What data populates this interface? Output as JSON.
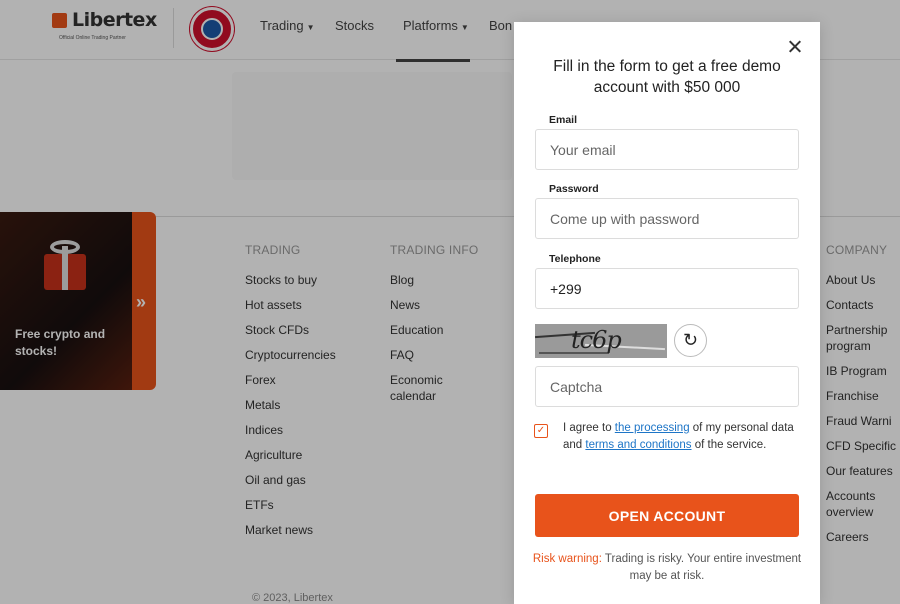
{
  "header": {
    "logo_text": "Libertex",
    "logo_subtitle": "Official Online Trading Partner",
    "nav": [
      {
        "label": "Trading"
      },
      {
        "label": "Stocks"
      },
      {
        "label": "Platforms"
      },
      {
        "label": "Bon"
      }
    ]
  },
  "promo": {
    "text": "Free crypto and stocks!",
    "chevron": "»"
  },
  "footer": {
    "columns": [
      {
        "heading": "TRADING",
        "items": [
          "Stocks to buy",
          "Hot assets",
          "Stock CFDs",
          "Cryptocurrencies",
          "Forex",
          "Metals",
          "Indices",
          "Agriculture",
          "Oil and gas",
          "ETFs",
          "Market news"
        ]
      },
      {
        "heading": "TRADING INFO",
        "items": [
          "Blog",
          "News",
          "Education",
          "FAQ",
          "Economic calendar"
        ]
      },
      {
        "heading": "COMPANY",
        "items": [
          "About Us",
          "Contacts",
          "Partnership program",
          "IB Program",
          "Franchise",
          "Fraud Warni",
          "CFD Specific",
          "Our features",
          "Accounts overview",
          "Careers"
        ]
      }
    ],
    "copyright": "© 2023, Libertex"
  },
  "modal": {
    "title": "Fill in the form to get a free demo account with $50 000",
    "email_label": "Email",
    "email_placeholder": "Your email",
    "password_label": "Password",
    "password_placeholder": "Come up with password",
    "telephone_label": "Telephone",
    "telephone_value": "+299",
    "captcha_text": "tc6p",
    "captcha_placeholder": "Captcha",
    "consent_prefix": "I agree to ",
    "consent_link1": "the processing",
    "consent_mid": " of my personal data and ",
    "consent_link2": "terms and conditions",
    "consent_suffix": " of the service.",
    "submit_label": "OPEN ACCOUNT",
    "risk_lead": "Risk warning:",
    "risk_text": " Trading is risky. Your entire investment may be at risk."
  },
  "colors": {
    "accent": "#e8531b",
    "link": "#1d75c7"
  }
}
